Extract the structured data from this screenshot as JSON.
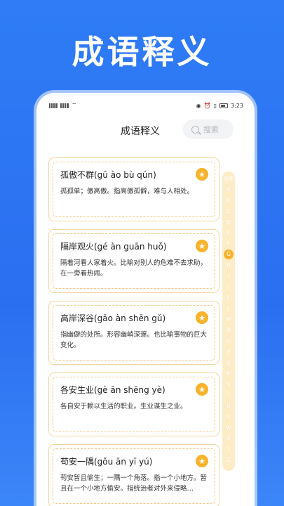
{
  "promo": {
    "title": "成语释义"
  },
  "status_bar": {
    "left": "4G 4G",
    "time": "3:23"
  },
  "header": {
    "title": "成语释义",
    "search_placeholder": "搜索"
  },
  "colors": {
    "accent": "#f6b32b",
    "card_border": "#f6d59a",
    "background": "#2f7cf6"
  },
  "idioms": [
    {
      "title": "孤傲不群(gū ào bù qún)",
      "desc": "孤孤单；傲高傲。指高傲孤僻，难与人相处。"
    },
    {
      "title": "隔岸观火(gé àn guān huǒ)",
      "desc": "隔着河看人家着火。比喻对别人的危难不去求助，在一旁看热闹。"
    },
    {
      "title": "高岸深谷(gāo àn shēn gǔ)",
      "desc": "指幽僻的处所。形容幽峭深邃。也比喻事物的巨大变化。"
    },
    {
      "title": "各安生业(gè ān shēng yè)",
      "desc": "各自安于赖以生活的职业。生业谋生之业。"
    },
    {
      "title": "苟安一隅(gǒu ān yī yú)",
      "desc": "苟安暂且偷生；一隅一个角落。指一个小地方。暂且在一个小地方偷安。指统治者对外来侵略…"
    }
  ],
  "index": {
    "all": "全部",
    "letters": [
      "A",
      "B",
      "C",
      "D",
      "E",
      "F",
      "G",
      "H",
      "I",
      "J",
      "K",
      "L",
      "M",
      "N",
      "O",
      "P",
      "Q",
      "R",
      "S",
      "T",
      "U",
      "V",
      "W",
      "X",
      "Y",
      "Z"
    ],
    "active": "G"
  }
}
